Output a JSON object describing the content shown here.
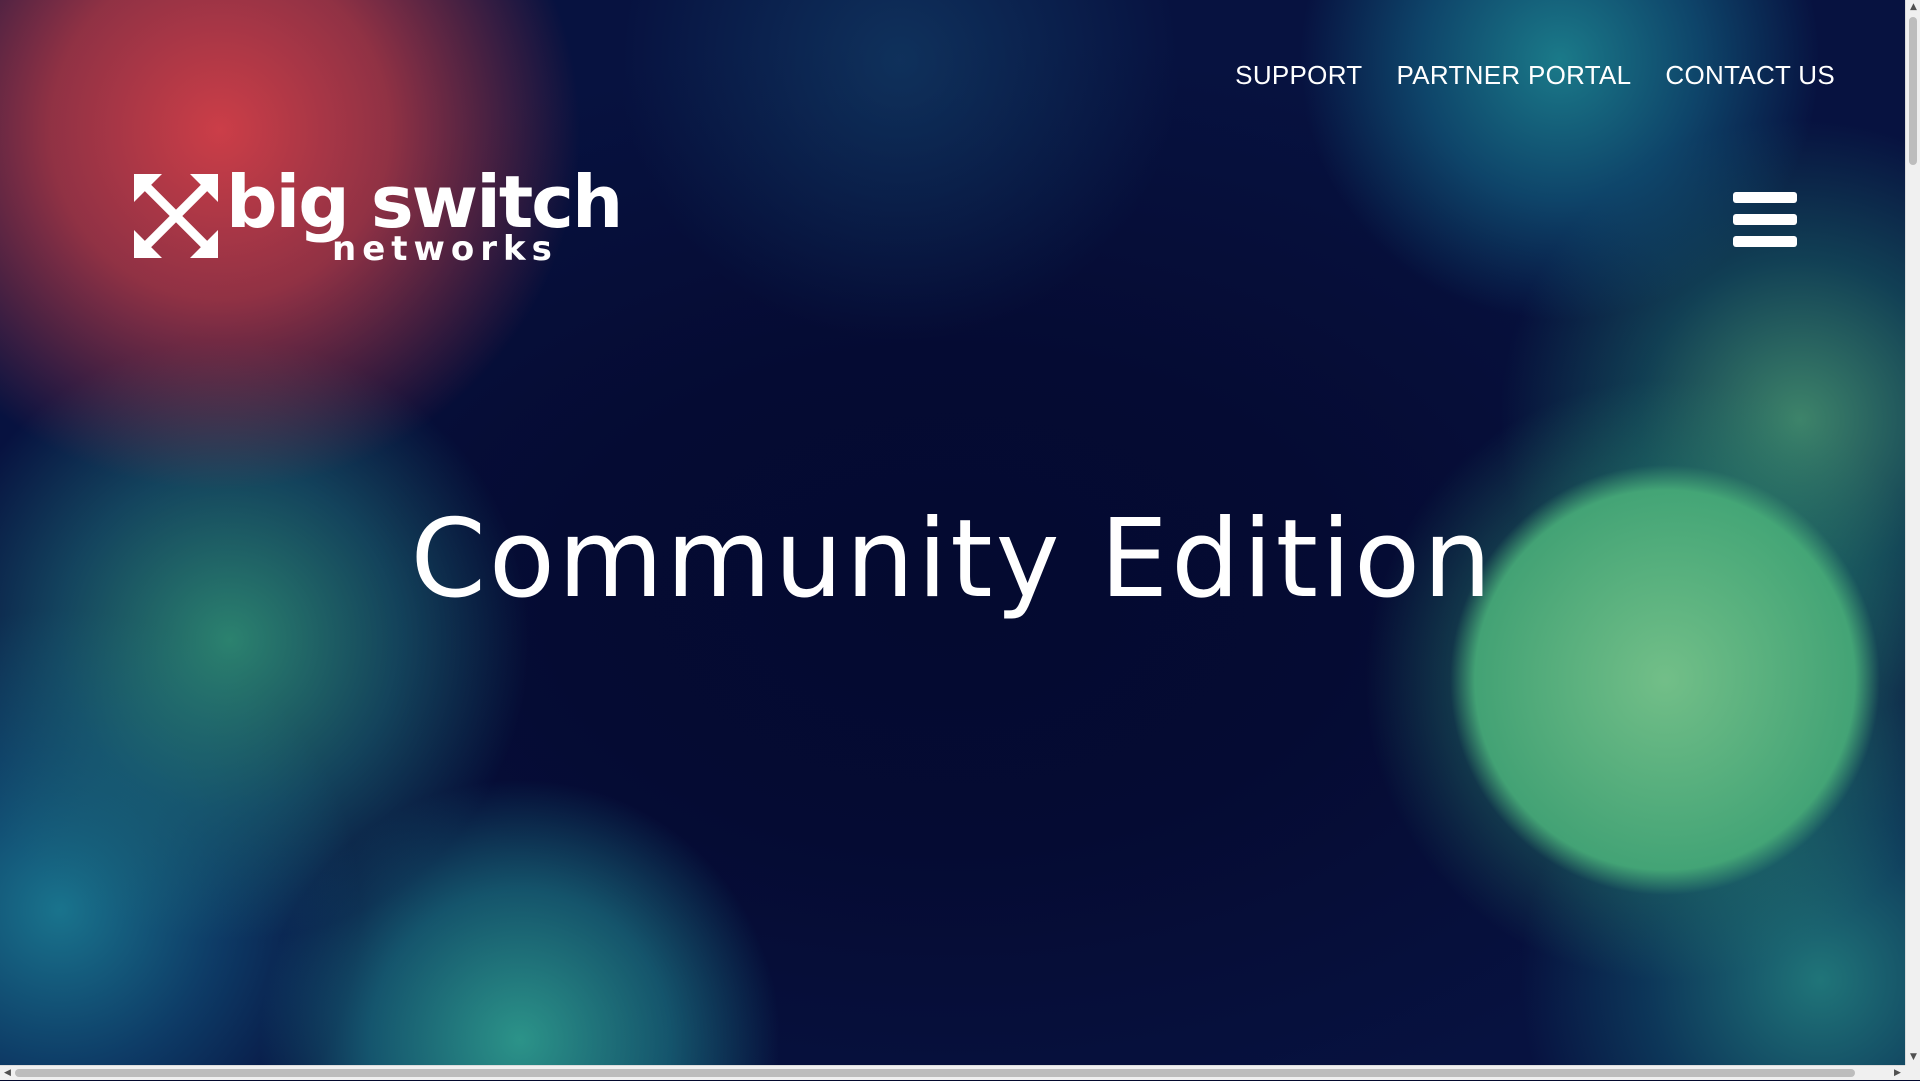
{
  "nav": {
    "items": [
      {
        "label": "SUPPORT"
      },
      {
        "label": "PARTNER PORTAL"
      },
      {
        "label": "CONTACT US"
      }
    ]
  },
  "logo": {
    "main": "big switch",
    "sub": "networks",
    "icon": "big-switch-arrows-icon"
  },
  "menu": {
    "icon": "hamburger-menu-icon"
  },
  "hero": {
    "title": "Community Edition"
  },
  "colors": {
    "text": "#ffffff",
    "background_dark": "#050a2e",
    "bokeh_red": "#d64048",
    "bokeh_green": "#78c88c",
    "bokeh_teal": "#1e8c96"
  },
  "scrollbars": {
    "up_arrow": "▲",
    "down_arrow": "▼",
    "left_arrow": "◀",
    "right_arrow": "▶"
  }
}
